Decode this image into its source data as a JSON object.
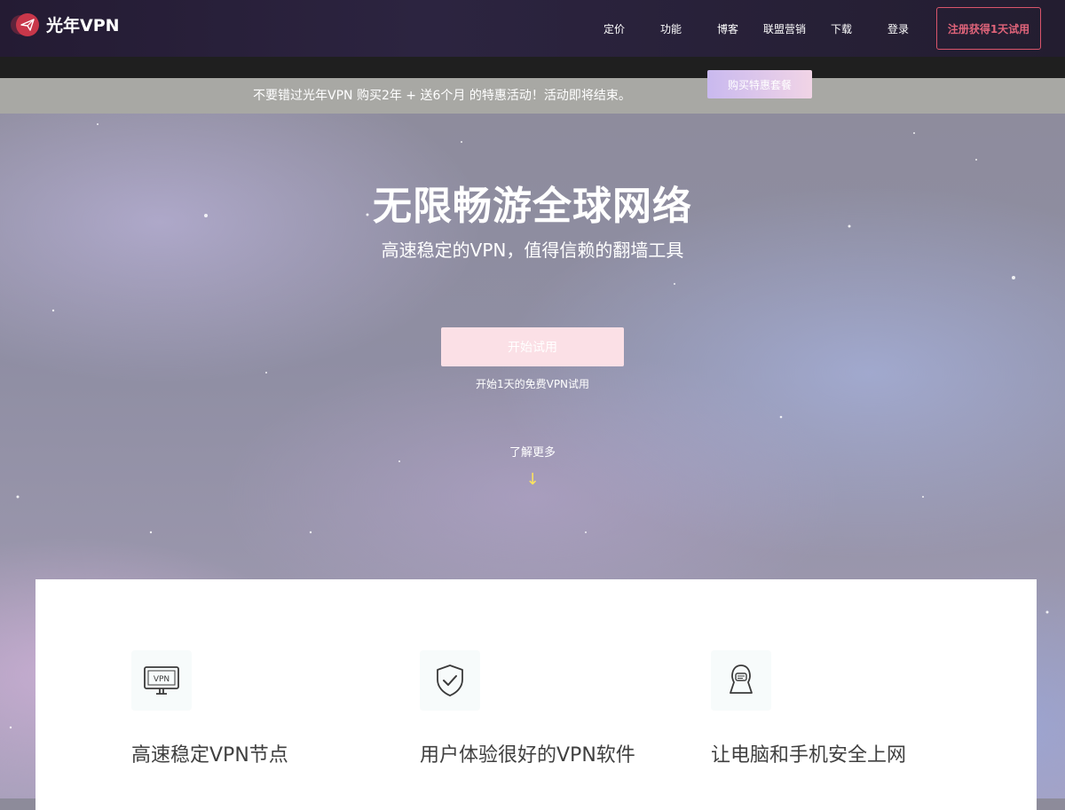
{
  "brand": {
    "name": "光年VPN"
  },
  "nav": {
    "items": [
      "定价",
      "功能",
      "博客",
      "联盟营销",
      "下载",
      "登录"
    ],
    "cta": "注册获得1天试用"
  },
  "promo": {
    "text": "不要错过光年VPN 购买2年 + 送6个月 的特惠活动！活动即将结束。",
    "button": "购买特惠套餐"
  },
  "hero": {
    "title": "无限畅游全球网络",
    "subtitle": "高速稳定的VPN，值得信赖的翻墙工具",
    "button": "开始试用",
    "note": "开始1天的免费VPN试用",
    "learn_more": "了解更多",
    "arrow": "↓"
  },
  "features": [
    {
      "icon": "monitor-vpn-icon",
      "title": "高速稳定VPN节点"
    },
    {
      "icon": "shield-check-icon",
      "title": "用户体验很好的VPN软件"
    },
    {
      "icon": "hooded-user-icon",
      "title": "让电脑和手机安全上网"
    }
  ],
  "colors": {
    "navbar": "#241b33",
    "accent": "#d9556b",
    "logo": "#c8374a",
    "promo_bar": "#a8a8a4",
    "arrow": "#ffe55b"
  }
}
